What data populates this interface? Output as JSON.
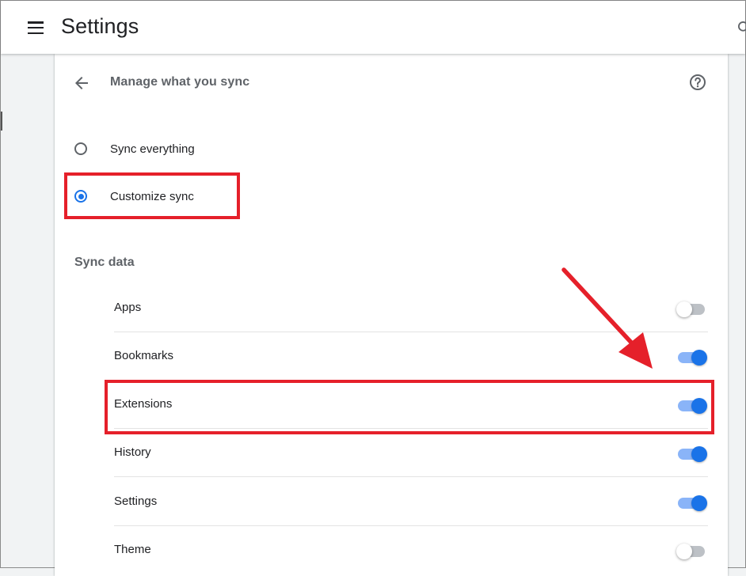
{
  "header": {
    "app_title": "Settings",
    "menu_icon": "hamburger-menu-icon",
    "search_icon": "search-icon"
  },
  "page": {
    "title": "Manage what you sync",
    "back_icon": "arrow-back-icon",
    "help_icon": "help-icon"
  },
  "sync_mode": {
    "options": [
      {
        "label": "Sync everything",
        "checked": false
      },
      {
        "label": "Customize sync",
        "checked": true
      }
    ]
  },
  "sync_data": {
    "heading": "Sync data",
    "items": [
      {
        "label": "Apps",
        "enabled": false
      },
      {
        "label": "Bookmarks",
        "enabled": true
      },
      {
        "label": "Extensions",
        "enabled": true
      },
      {
        "label": "History",
        "enabled": true
      },
      {
        "label": "Settings",
        "enabled": true
      },
      {
        "label": "Theme",
        "enabled": false
      }
    ]
  },
  "colors": {
    "accent": "#1a73e8",
    "toggle_track_on": "#8ab4f8",
    "toggle_track_off": "#bdc1c6",
    "annotation": "#e5202a"
  }
}
